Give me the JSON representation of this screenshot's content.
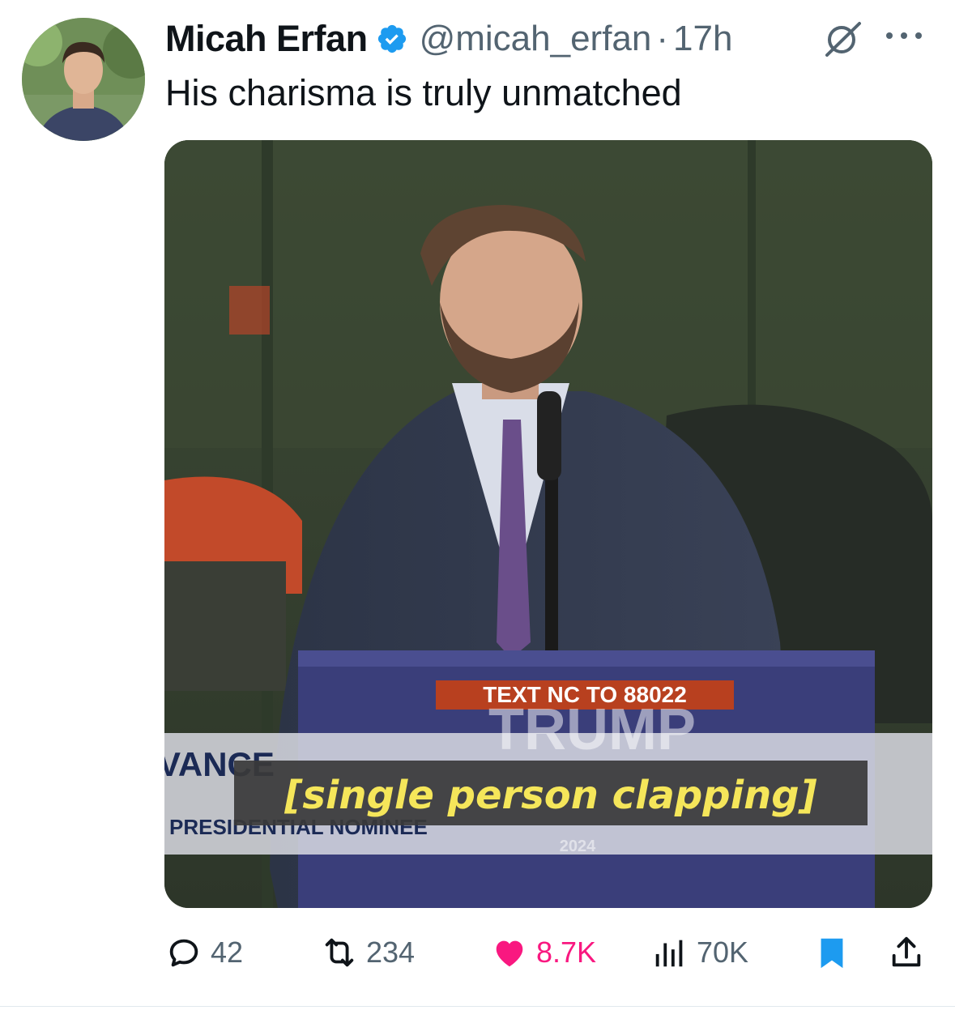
{
  "author": {
    "name": "Micah Erfan",
    "handle": "@micah_erfan",
    "separator": "·",
    "time": "17h",
    "verified_icon": "verified-badge-icon",
    "verified_color": "#1d9bf0"
  },
  "tweet": {
    "text": "His charisma is truly unmatched"
  },
  "media": {
    "podium_sign_top": "TEXT NC TO 88022",
    "podium_sign_name": "TRUMP",
    "lower_third_name": "VANCE",
    "lower_third_title": "PRESIDENTIAL NOMINEE",
    "podium_year": "2024",
    "caption": "[single person clapping]"
  },
  "actions": {
    "replies": "42",
    "reposts": "234",
    "likes": "8.7K",
    "views": "70K",
    "like_color": "#f91880",
    "bookmark_color": "#1d9bf0"
  }
}
